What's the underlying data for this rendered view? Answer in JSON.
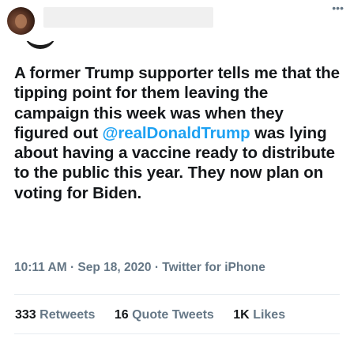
{
  "tweet": {
    "more_icon": "more-horizontal-icon",
    "text_before": "A former Trump supporter tells me that the tipping point for them leaving the campaign this week was when they figured out ",
    "mention": "@realDonaldTrump",
    "text_after": " was lying about having a vaccine ready to distribute to the public this year. They now plan on voting for Biden.",
    "time": "10:11 AM",
    "separator": "·",
    "date": "Sep 18, 2020",
    "source": "Twitter for iPhone"
  },
  "stats": [
    {
      "count": "333",
      "label": "Retweets"
    },
    {
      "count": "16",
      "label": "Quote Tweets"
    },
    {
      "count": "1K",
      "label": "Likes"
    }
  ],
  "colors": {
    "text": "#14171a",
    "muted": "#657786",
    "link": "#1da1f2",
    "divider": "#e6ecf0"
  }
}
